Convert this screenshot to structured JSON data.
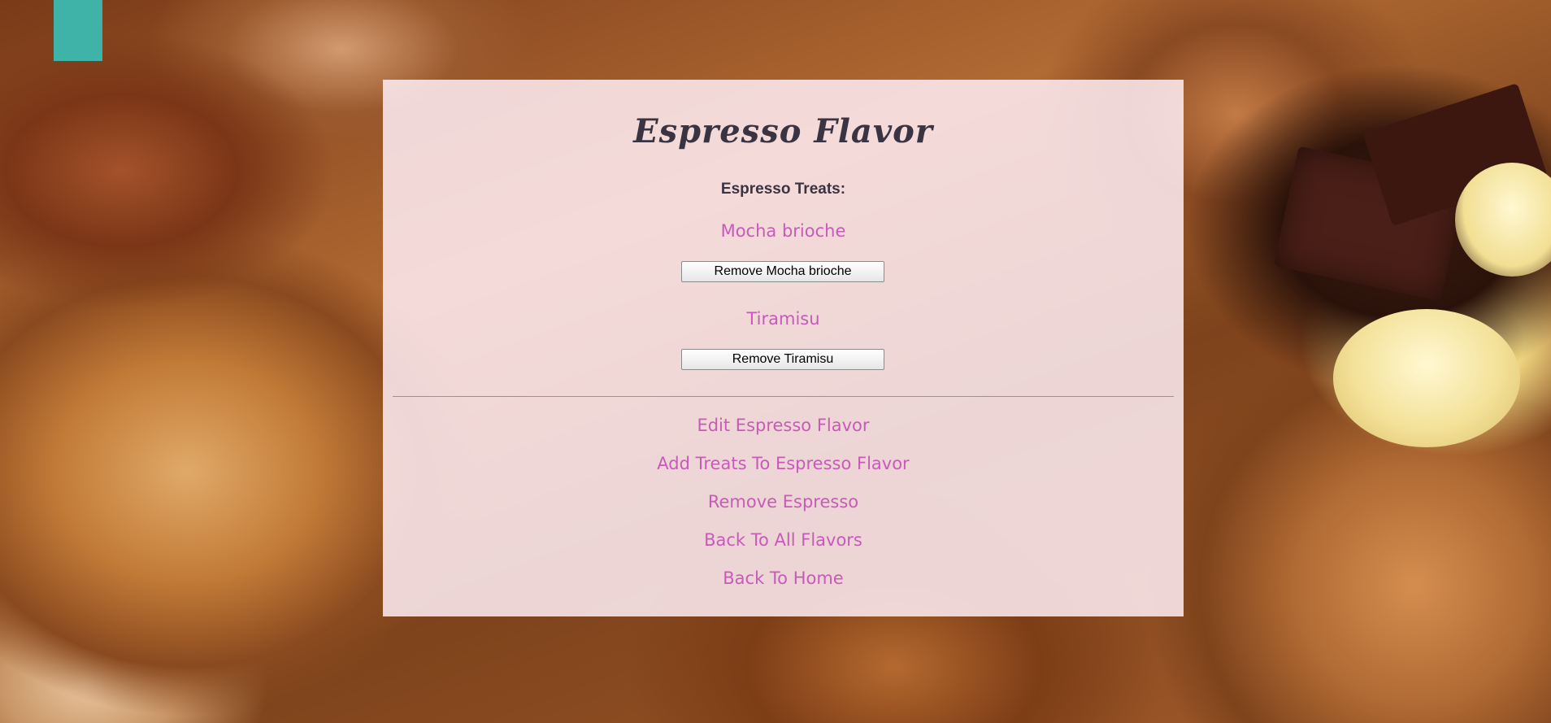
{
  "page": {
    "title": "Espresso Flavor",
    "treats_heading": "Espresso Treats:"
  },
  "treats": [
    {
      "name": "Mocha brioche",
      "remove_label": "Remove Mocha brioche"
    },
    {
      "name": "Tiramisu",
      "remove_label": "Remove Tiramisu"
    }
  ],
  "nav": {
    "edit": "Edit Espresso Flavor",
    "add_treats": "Add Treats To Espresso Flavor",
    "remove_flavor": "Remove Espresso",
    "back_flavors": "Back To All Flavors",
    "back_home": "Back To Home"
  },
  "colors": {
    "link": "#c85ab9",
    "heading": "#3a3342",
    "card_background": "#ffeef4"
  }
}
